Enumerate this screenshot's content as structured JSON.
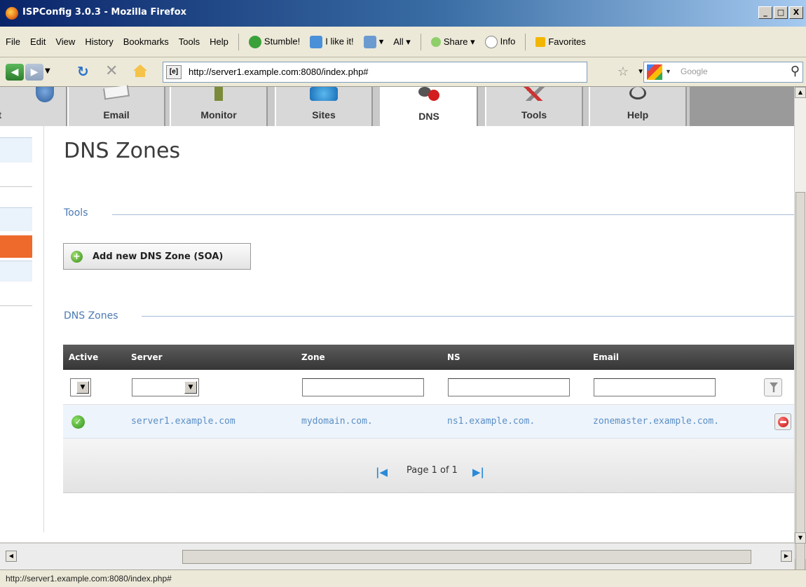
{
  "window": {
    "title": "ISPConfig 3.0.3 - Mozilla Firefox",
    "controls": [
      "_",
      "□",
      "X"
    ]
  },
  "menu": {
    "items": [
      "File",
      "Edit",
      "View",
      "History",
      "Bookmarks",
      "Tools",
      "Help"
    ],
    "toolbar": {
      "stumble": "Stumble!",
      "ilike": "I like it!",
      "all": "All",
      "share": "Share",
      "info": "Info",
      "favorites": "Favorites"
    }
  },
  "nav": {
    "url": "http://server1.example.com:8080/index.php#",
    "search_placeholder": "Google"
  },
  "tabs": [
    "lient",
    "Email",
    "Monitor",
    "Sites",
    "DNS",
    "Tools",
    "Help"
  ],
  "active_tab": "DNS",
  "page": {
    "title": "DNS Zones",
    "tools_label": "Tools",
    "add_button": "Add new DNS Zone (SOA)",
    "list_label": "DNS Zones"
  },
  "table": {
    "headers": [
      "Active",
      "Server",
      "Zone",
      "NS",
      "Email"
    ],
    "rows": [
      {
        "active": true,
        "server": "server1.example.com",
        "zone": "mydomain.com.",
        "ns": "ns1.example.com.",
        "email": "zonemaster.example.com."
      }
    ],
    "pager": "Page 1 of 1"
  },
  "status": {
    "text": "http://server1.example.com:8080/index.php#"
  },
  "colors": {
    "accent": "#4a7ab3",
    "link": "#5a8fc6",
    "header_bg": "#3f3f3f",
    "sidebar_highlight": "#ee6a2c"
  }
}
